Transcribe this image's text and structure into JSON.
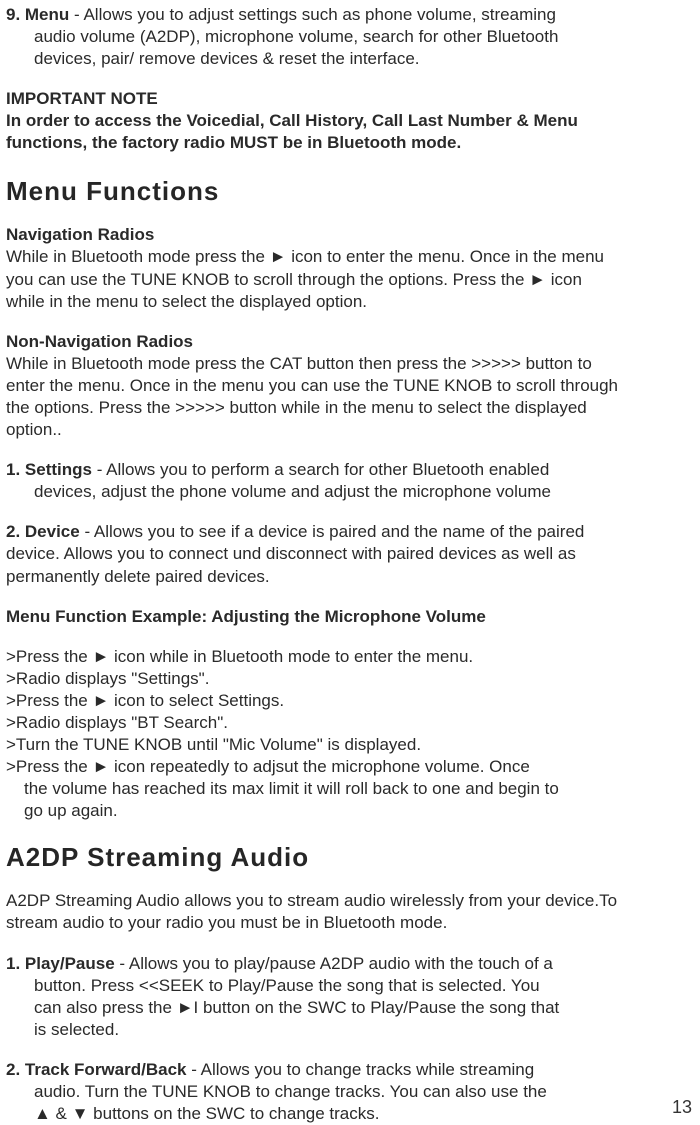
{
  "item9": {
    "label": "9. Menu",
    "text_line1": " - Allows you to adjust settings such as phone volume, streaming",
    "text_line2": "audio volume (A2DP), microphone volume, search for other Bluetooth",
    "text_line3": "devices, pair/ remove devices & reset the interface."
  },
  "important_note": {
    "title": "IMPORTANT NOTE",
    "body1": "In order to access the Voicedial, Call History, Call Last Number & Menu",
    "body2": "functions, the factory radio MUST be in Bluetooth mode."
  },
  "menu_functions_heading": "Menu Functions",
  "nav_radios": {
    "heading": "Navigation Radios",
    "line1": "While in Bluetooth mode press the ► icon to enter the menu. Once in the menu",
    "line2": "you can use the TUNE KNOB to scroll through the options. Press the ► icon",
    "line3": "while in the menu to select the displayed option."
  },
  "non_nav_radios": {
    "heading": "Non-Navigation Radios",
    "line1": "While in Bluetooth mode press the CAT button then press the >>>>> button to",
    "line2": "enter the menu. Once in the menu you can use the TUNE KNOB to scroll through",
    "line3": "the options. Press the >>>>> button while in the menu to select the displayed",
    "line4": "option.."
  },
  "settings": {
    "label": "1. Settings",
    "line1": " - Allows you to perform a search for other Bluetooth enabled",
    "line2": "devices, adjust the phone volume and adjust the microphone volume"
  },
  "device": {
    "label": "2. Device",
    "line1": " - Allows you to see if a device is paired and the name of the paired",
    "line2": "device. Allows you to connect und disconnect with paired devices as well as",
    "line3": "permanently delete paired devices."
  },
  "example_heading": "Menu Function Example: Adjusting the Microphone Volume",
  "steps": {
    "s1": ">Press the ► icon while in Bluetooth mode to enter the menu.",
    "s2": ">Radio displays \"Settings\".",
    "s3": ">Press the ► icon to select Settings.",
    "s4": ">Radio displays \"BT Search\".",
    "s5": ">Turn the TUNE KNOB until \"Mic Volume\" is displayed.",
    "s6": ">Press the ► icon repeatedly to adjsut the microphone volume. Once",
    "s6b": "the volume has reached its max limit it will roll back to one and begin to",
    "s6c": "go up again."
  },
  "a2dp_heading": "A2DP Streaming Audio",
  "a2dp_intro": {
    "line1": "A2DP Streaming Audio allows you to stream audio wirelessly from your device.To",
    "line2": "stream audio to your radio you must be in Bluetooth mode."
  },
  "play_pause": {
    "label": "1. Play/Pause",
    "line1": " - Allows you to play/pause A2DP audio with the touch of a",
    "line2": "button. Press <<SEEK to Play/Pause the song that is selected. You",
    "line3": "can also press the ►I button on the SWC to Play/Pause the song that",
    "line4": "is selected."
  },
  "track": {
    "label": "2. Track Forward/Back",
    "line1": " - Allows you to change tracks while streaming",
    "line2": "audio. Turn the TUNE KNOB to change tracks. You can also use the",
    "line3": "▲ & ▼ buttons on the SWC to change tracks."
  },
  "page_number": "13"
}
